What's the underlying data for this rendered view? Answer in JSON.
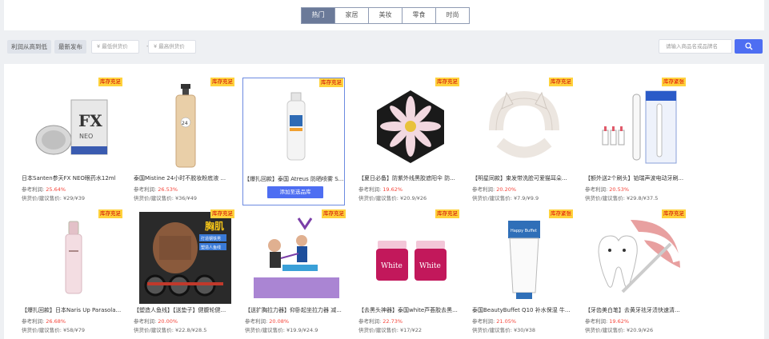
{
  "tabs": [
    "热门",
    "家居",
    "美妆",
    "零食",
    "时尚"
  ],
  "filters": {
    "sort_profit": "利润从高到低",
    "sort_new": "最新发布",
    "min_price_placeholder": "¥ 最低供货价",
    "max_price_placeholder": "¥ 最高供货价",
    "dash": "-",
    "search_placeholder": "请输入商品名或品牌名"
  },
  "labels": {
    "profit_prefix": "参考利润:",
    "price_prefix": "供货价/建议售价:",
    "add_button": "添加至选品库"
  },
  "products": [
    {
      "title": "日本Santen参天FX NEO眼药水12ml",
      "profit": "25.64%",
      "price": "¥29/¥39",
      "badge": "库存充足",
      "icon": "eye-drops-image"
    },
    {
      "title": "泰国Mistine 24小时不脱妆粉底液 ...",
      "profit": "26.53%",
      "price": "¥36/¥49",
      "badge": "库存充足",
      "icon": "foundation-bottle-image"
    },
    {
      "title": "【爆扎回款】泰国 Atreus 防晒喷雾 S...",
      "profit": "",
      "price": "",
      "badge": "库存充足",
      "icon": "sunscreen-spray-image"
    },
    {
      "title": "【夏日必备】防紫外线黑胶遮阳伞 防...",
      "profit": "19.62%",
      "price": "¥20.9/¥26",
      "badge": "库存充足",
      "icon": "umbrella-image"
    },
    {
      "title": "【明星同款】束发带洗脸可爱猫耳朵...",
      "profit": "20.20%",
      "price": "¥7.9/¥9.9",
      "badge": "库存充足",
      "icon": "headband-image"
    },
    {
      "title": "【额外送2个刷头】铂瑞声波电动牙刷...",
      "profit": "20.53%",
      "price": "¥29.8/¥37.5",
      "badge": "库存紧张",
      "icon": "electric-toothbrush-image"
    },
    {
      "title": "【爆扎回款】日本Naris Up Parasola...",
      "profit": "26.68%",
      "price": "¥58/¥79",
      "badge": "库存充足",
      "icon": "spray-bottle-image"
    },
    {
      "title": "【塑造人鱼线】【送垫子】健腹轮健...",
      "profit": "20.00%",
      "price": "¥22.8/¥28.5",
      "badge": "库存充足",
      "icon": "ab-wheel-image"
    },
    {
      "title": "【送扩胸拉力器】仰卧起坐拉力器 减...",
      "profit": "20.08%",
      "price": "¥19.9/¥24.9",
      "badge": "库存充足",
      "icon": "resistance-band-image"
    },
    {
      "title": "【去黑头神器】泰国white芦荟胶去黑...",
      "profit": "22.73%",
      "price": "¥17/¥22",
      "badge": "库存充足",
      "icon": "cream-jars-image"
    },
    {
      "title": "泰国BeautyBuffet Q10 补水保湿 牛...",
      "profit": "21.05%",
      "price": "¥30/¥38",
      "badge": "库存紧张",
      "icon": "cleanser-tube-image"
    },
    {
      "title": "【牙齿美白笔】去黄牙祛牙渍快速清...",
      "profit": "19.62%",
      "price": "¥20.9/¥26",
      "badge": "库存充足",
      "icon": "teeth-whitening-image"
    }
  ],
  "images": {
    "graphic_texts": [
      "FX",
      "NEO",
      "24",
      "胸肌",
      "打造钢铁男",
      "塑造人鱼线",
      "White",
      "Happy Buffet"
    ]
  }
}
